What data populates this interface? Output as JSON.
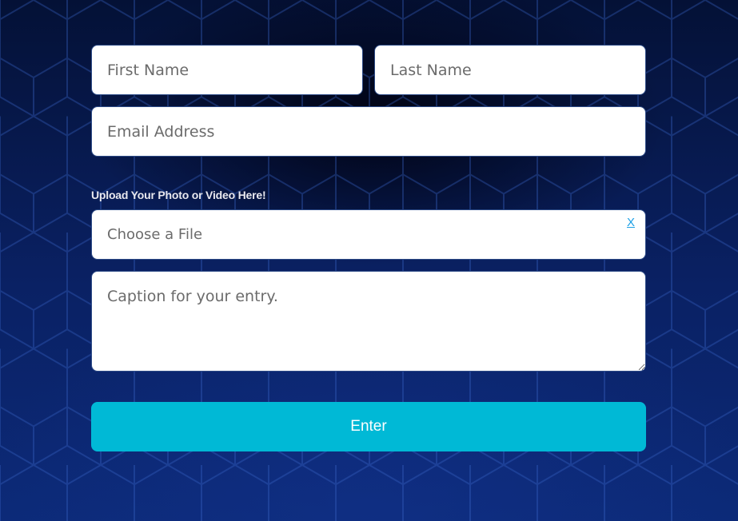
{
  "form": {
    "first_name": {
      "placeholder": "First Name",
      "value": ""
    },
    "last_name": {
      "placeholder": "Last Name",
      "value": ""
    },
    "email": {
      "placeholder": "Email Address",
      "value": ""
    },
    "upload": {
      "label": "Upload Your Photo or Video Here!",
      "choose_text": "Choose a File",
      "clear_label": "X"
    },
    "caption": {
      "placeholder": "Caption for your entry.",
      "value": ""
    },
    "submit_label": "Enter"
  },
  "colors": {
    "background": "#0a1f5c",
    "accent": "#00b9d6",
    "clear_link": "#1ea0e6",
    "label_text": "#e8e8ee"
  },
  "icons": {
    "background_pattern": "hexagon-pattern"
  }
}
